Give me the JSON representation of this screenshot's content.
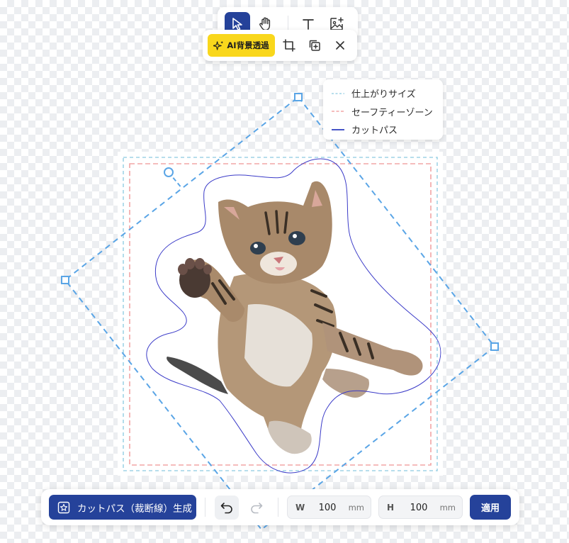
{
  "toolbar": {
    "tools": [
      {
        "name": "select",
        "icon": "cursor-arrow-icon",
        "active": true
      },
      {
        "name": "pan",
        "icon": "hand-icon",
        "active": false
      },
      {
        "name": "text",
        "icon": "text-icon",
        "active": false
      },
      {
        "name": "add-image",
        "icon": "image-add-icon",
        "active": false
      }
    ]
  },
  "image_toolbar": {
    "ai_remove_bg_label": "AI背景透過",
    "ai_icon": "sparkle-icon",
    "crop_icon": "crop-icon",
    "duplicate_icon": "duplicate-icon",
    "close_icon": "close-icon"
  },
  "legend": {
    "items": [
      {
        "label": "仕上がりサイズ",
        "style": "dotted",
        "color": "#9fd3e6"
      },
      {
        "label": "セーフティーゾーン",
        "style": "dashed",
        "color": "#f2a5a5"
      },
      {
        "label": "カットパス",
        "style": "solid",
        "color": "#2b3bbf"
      }
    ]
  },
  "canvas": {
    "image_subject": "kitten (background removed)",
    "selection_color": "#5aa5e6",
    "cut_path_color": "#3b3bc8"
  },
  "bottom_bar": {
    "generate_label": "カットパス（裁断線）生成",
    "generate_icon": "sticker-outline-icon",
    "undo_icon": "undo-icon",
    "redo_icon": "redo-icon",
    "width_label": "W",
    "width_value": "100",
    "width_unit": "mm",
    "height_label": "H",
    "height_value": "100",
    "height_unit": "mm",
    "apply_label": "適用"
  },
  "colors": {
    "primary": "#25429a",
    "ai_button": "#f9d71c"
  }
}
